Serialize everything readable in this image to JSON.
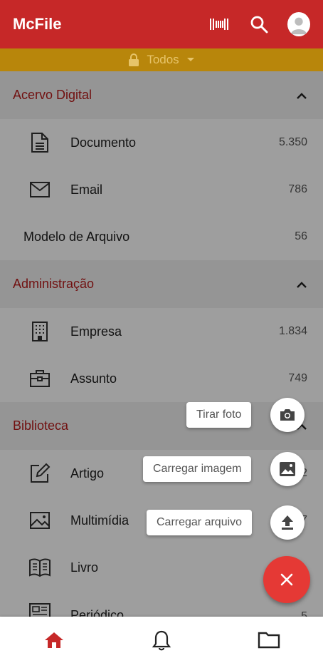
{
  "app": {
    "title": "McFile"
  },
  "filter": {
    "label": "Todos"
  },
  "sections": [
    {
      "title": "Acervo Digital",
      "items": [
        {
          "label": "Documento",
          "count": "5.350"
        },
        {
          "label": "Email",
          "count": "786"
        },
        {
          "label": "Modelo de Arquivo",
          "count": "56"
        }
      ]
    },
    {
      "title": "Administração",
      "items": [
        {
          "label": "Empresa",
          "count": "1.834"
        },
        {
          "label": "Assunto",
          "count": "749"
        }
      ]
    },
    {
      "title": "Biblioteca",
      "items": [
        {
          "label": "Artigo",
          "count": "2"
        },
        {
          "label": "Multimídia",
          "count": "7"
        },
        {
          "label": "Livro",
          "count": ""
        },
        {
          "label": "Periódico",
          "count": "5"
        }
      ]
    }
  ],
  "fab_menu": {
    "take_photo": "Tirar foto",
    "upload_image": "Carregar imagem",
    "upload_file": "Carregar arquivo"
  },
  "colors": {
    "primary": "#c62828",
    "filter_bar": "#b8860b",
    "fab": "#e53935",
    "section_title": "#b71c1c"
  }
}
